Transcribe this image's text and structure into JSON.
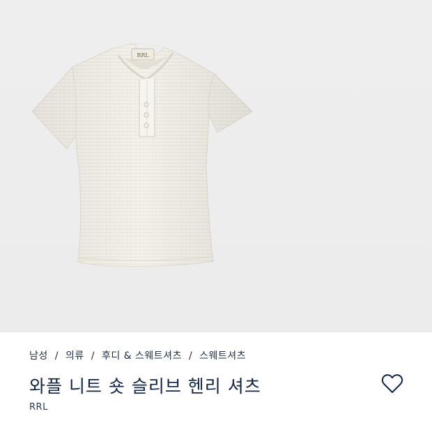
{
  "breadcrumb": {
    "items": [
      "남성",
      "의류",
      "후디 & 스웨트셔츠",
      "스웨트셔츠"
    ],
    "separator": "/"
  },
  "product": {
    "title": "와플 니트 숏 슬리브 헨리 셔츠",
    "brand": "RRL",
    "tag_label": "RRL",
    "image_icon": "henley-shirt-image"
  },
  "actions": {
    "wishlist_icon": "heart-icon"
  },
  "colors": {
    "image_background": "#eeeeee",
    "text_navy": "#0f2444",
    "shirt": "#f3f1ea"
  }
}
